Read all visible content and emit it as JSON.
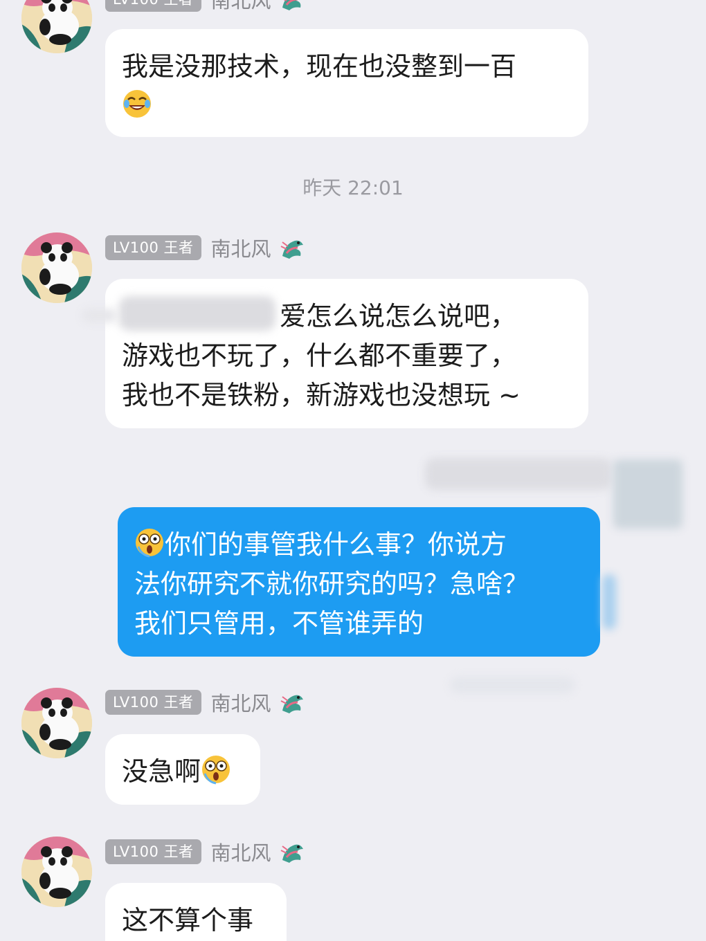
{
  "sender": {
    "level_badge": "LV100 王者",
    "name": "南北风"
  },
  "timestamp": "昨天 22:01",
  "messages": {
    "m0_line1": "我是没那技术，现在也没整到一百",
    "m1_line1": "爱怎么说怎么说吧，",
    "m1_line2": "游戏也不玩了，什么都不重要了，",
    "m1_line3": "我也不是铁粉，新游戏也没想玩 ~",
    "m2_line1": "你们的事管我什么事？你说方",
    "m2_line2": "法你研究不就你研究的吗？急啥？",
    "m2_line3": "我们只管用，不管谁弄的",
    "m3_text": "没急啊",
    "m4_text": "这不算个事"
  },
  "colors": {
    "background": "#eeeef3",
    "incoming_bubble": "#ffffff",
    "outgoing_bubble": "#1d9cf2",
    "badge": "#a9a9ae"
  },
  "icons": {
    "emoji_laugh": "laughing-tears-emoji-icon",
    "emoji_shock": "shocked-emoji-icon",
    "title": "dragon-title-icon"
  }
}
